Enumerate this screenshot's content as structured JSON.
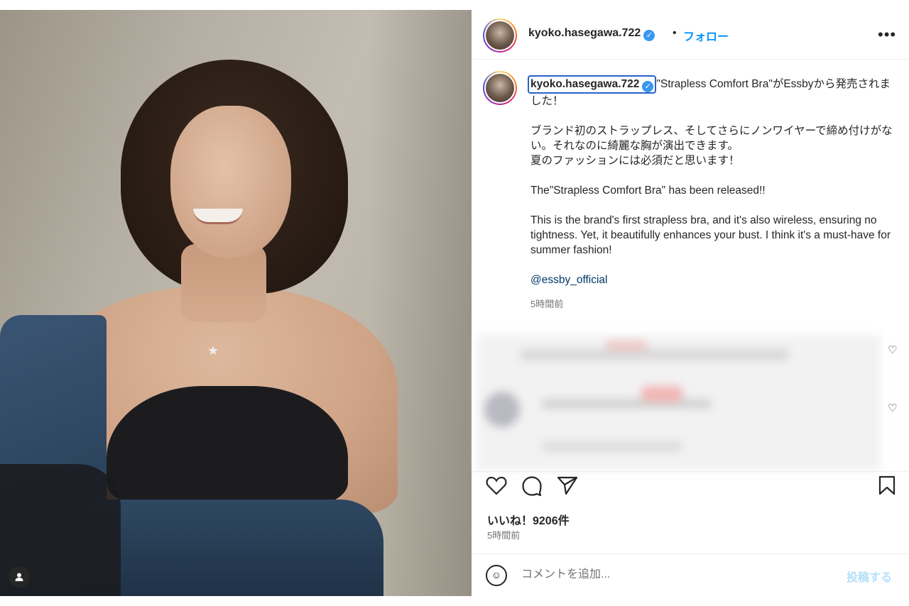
{
  "header": {
    "username": "kyoko.hasegawa.722",
    "verified_glyph": "✓",
    "separator": "•",
    "follow_label": "フォロー",
    "more_icon": "more-horizontal-icon",
    "more_glyph": "•••"
  },
  "caption": {
    "username": "kyoko.hasegawa.722",
    "lead": "\"Strapless Comfort Bra\"がEssbyから発売されました！",
    "jp_paragraph": "ブランド初のストラップレス、そしてさらにノンワイヤーで締め付けがない。それなのに綺麗な胸が演出できます。\n夏のファッションには必須だと思います！",
    "en_headline": "The\"Strapless Comfort Bra\" has been released!!",
    "en_paragraph": "This is the brand's first strapless bra, and it's also wireless, ensuring no tightness. Yet, it beautifully enhances your bust. I think it's a must-have for summer fashion!",
    "mention": "@essby_official",
    "time": "5時間前"
  },
  "actions": {
    "like_icon": "heart-icon",
    "comment_icon": "comment-icon",
    "share_icon": "send-icon",
    "save_icon": "bookmark-icon",
    "like_glyph": "♡",
    "comment_glyph": "◯",
    "share_glyph": "➢",
    "save_glyph": "⊓"
  },
  "stats": {
    "likes": "いいね！9206件",
    "time": "5時間前"
  },
  "comment_box": {
    "emoji_glyph": "☺",
    "placeholder": "コメントを追加...",
    "post_label": "投稿する"
  },
  "colors": {
    "link_blue": "#0095f6",
    "verified_blue": "#3897f0",
    "mention": "#00376b",
    "post_disabled": "#b2dffc"
  },
  "comment_hearts": [
    "♡",
    "♡"
  ]
}
